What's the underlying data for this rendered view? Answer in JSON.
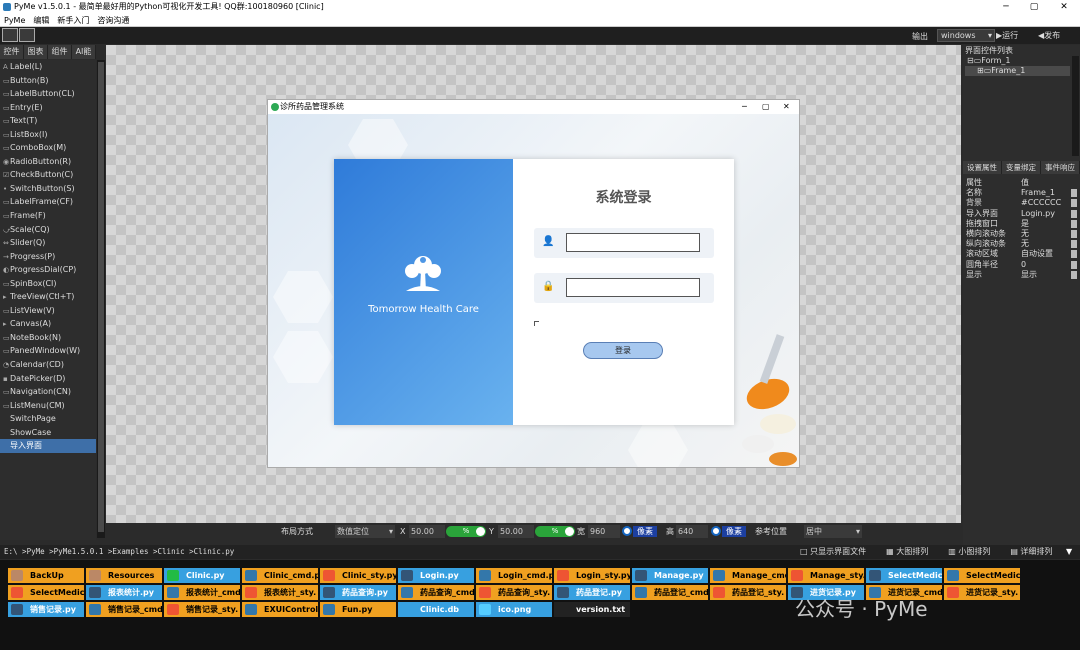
{
  "app": {
    "title": "PyMe v1.5.0.1 - 最简单最好用的Python可视化开发工具! QQ群:100180960    [Clinic]"
  },
  "menu": [
    "PyMe",
    "编辑",
    "新手入门",
    "咨询沟通"
  ],
  "toolbar": {
    "output_label": "输出",
    "platform": "windows",
    "run": "▶运行",
    "publish": "◀发布"
  },
  "left_tabs": [
    "控件",
    "图表",
    "组件",
    "AI能力"
  ],
  "controls": [
    {
      "icon": "A",
      "label": "Label(L)"
    },
    {
      "icon": "▭",
      "label": "Button(B)"
    },
    {
      "icon": "▭",
      "label": "LabelButton(CL)"
    },
    {
      "icon": "▭",
      "label": "Entry(E)"
    },
    {
      "icon": "▭",
      "label": "Text(T)"
    },
    {
      "icon": "▭",
      "label": "ListBox(I)"
    },
    {
      "icon": "▭",
      "label": "ComboBox(M)"
    },
    {
      "icon": "◉",
      "label": "RadioButton(R)"
    },
    {
      "icon": "☑",
      "label": "CheckButton(C)"
    },
    {
      "icon": "•",
      "label": "SwitchButton(S)"
    },
    {
      "icon": "▭",
      "label": "LabelFrame(CF)"
    },
    {
      "icon": "▭",
      "label": "Frame(F)"
    },
    {
      "icon": "⤻",
      "label": "Scale(CQ)"
    },
    {
      "icon": "⇔",
      "label": "Slider(Q)"
    },
    {
      "icon": "→",
      "label": "Progress(P)"
    },
    {
      "icon": "◐",
      "label": "ProgressDial(CP)"
    },
    {
      "icon": "▭",
      "label": "SpinBox(CI)"
    },
    {
      "icon": "▸",
      "label": "TreeView(Ctl+T)"
    },
    {
      "icon": "▭",
      "label": "ListView(V)"
    },
    {
      "icon": "▸",
      "label": "Canvas(A)"
    },
    {
      "icon": "▭",
      "label": "NoteBook(N)"
    },
    {
      "icon": "▭",
      "label": "PanedWindow(W)"
    },
    {
      "icon": "◔",
      "label": "Calendar(CD)"
    },
    {
      "icon": "▪",
      "label": "DatePicker(D)"
    },
    {
      "icon": "▭",
      "label": "Navigation(CN)"
    },
    {
      "icon": "▭",
      "label": "ListMenu(CM)"
    },
    {
      "icon": "",
      "label": "SwitchPage"
    },
    {
      "icon": "",
      "label": "ShowCase"
    },
    {
      "icon": "",
      "label": "导入界面"
    }
  ],
  "form": {
    "title": "诊所药品管理系统",
    "brand": "Tomorrow Health Care",
    "login_title": "系统登录",
    "login_button": "登录"
  },
  "right": {
    "title": "界面控件列表",
    "tree": [
      "⊟▭Form_1",
      "⊞▭Frame_1"
    ],
    "tabs": [
      "设置属性",
      "变量绑定",
      "事件响应"
    ],
    "props_header": {
      "k": "属性",
      "v": "值"
    },
    "props": [
      {
        "k": "名称",
        "v": "Frame_1"
      },
      {
        "k": "背景",
        "v": "#CCCCCC"
      },
      {
        "k": "导入界面",
        "v": "Login.py"
      },
      {
        "k": "拖拽窗口",
        "v": "是"
      },
      {
        "k": "横向滚动条",
        "v": "无"
      },
      {
        "k": "纵向滚动条",
        "v": "无"
      },
      {
        "k": "滚动区域",
        "v": "自动设置"
      },
      {
        "k": "圆角半径",
        "v": "0"
      },
      {
        "k": "显示",
        "v": "显示"
      }
    ]
  },
  "status": {
    "layout": "布局方式",
    "layout_value": "数值定位",
    "x_label": "X",
    "x_val": "50.00",
    "pct": "%",
    "y_label": "Y",
    "y_val": "50.00",
    "w_label": "宽",
    "w_val": "960",
    "unit": "像素",
    "h_label": "高",
    "h_val": "640",
    "anchor_label": "参考位置",
    "anchor_val": "居中"
  },
  "path": "E:\\ >PyMe >PyMe1.5.0.1 >Examples >Clinic >Clinic.py",
  "view_options": [
    "□ 只显示界面文件",
    "▦ 大图排列",
    "▥ 小图排列",
    "▤ 详细排列"
  ],
  "files": [
    {
      "name": "BackUp",
      "bg": "#f0a020",
      "fg": "#000",
      "ic": "#b86"
    },
    {
      "name": "Resources",
      "bg": "#f0a020",
      "fg": "#000",
      "ic": "#b86"
    },
    {
      "name": "Clinic.py",
      "bg": "#37a0e0",
      "fg": "#fff",
      "ic": "#2b4"
    },
    {
      "name": "Clinic_cmd.py",
      "bg": "#f0a020",
      "fg": "#000",
      "ic": "#37a"
    },
    {
      "name": "Clinic_sty.py",
      "bg": "#f0a020",
      "fg": "#000",
      "ic": "#e53"
    },
    {
      "name": "Login.py",
      "bg": "#37a0e0",
      "fg": "#fff",
      "ic": "#357"
    },
    {
      "name": "Login_cmd.py",
      "bg": "#f0a020",
      "fg": "#000",
      "ic": "#37a"
    },
    {
      "name": "Login_sty.py",
      "bg": "#f0a020",
      "fg": "#000",
      "ic": "#e53"
    },
    {
      "name": "Manage.py",
      "bg": "#37a0e0",
      "fg": "#fff",
      "ic": "#357"
    },
    {
      "name": "Manage_cmd.py",
      "bg": "#f0a020",
      "fg": "#000",
      "ic": "#37a"
    },
    {
      "name": "Manage_sty.py",
      "bg": "#f0a020",
      "fg": "#000",
      "ic": "#e53"
    },
    {
      "name": "SelectMedicD",
      "bg": "#37a0e0",
      "fg": "#fff",
      "ic": "#357"
    },
    {
      "name": "SelectMedicD",
      "bg": "#f0a020",
      "fg": "#000",
      "ic": "#37a"
    },
    {
      "name": "SelectMedicD",
      "bg": "#f0a020",
      "fg": "#000",
      "ic": "#e53"
    },
    {
      "name": "报表统计.py",
      "bg": "#37a0e0",
      "fg": "#fff",
      "ic": "#357"
    },
    {
      "name": "报表统计_cmd",
      "bg": "#f0a020",
      "fg": "#000",
      "ic": "#37a"
    },
    {
      "name": "报表统计_sty.",
      "bg": "#f0a020",
      "fg": "#000",
      "ic": "#e53"
    },
    {
      "name": "药品查询.py",
      "bg": "#37a0e0",
      "fg": "#fff",
      "ic": "#357"
    },
    {
      "name": "药品查询_cmd",
      "bg": "#f0a020",
      "fg": "#000",
      "ic": "#37a"
    },
    {
      "name": "药品查询_sty.",
      "bg": "#f0a020",
      "fg": "#000",
      "ic": "#e53"
    },
    {
      "name": "药品登记.py",
      "bg": "#37a0e0",
      "fg": "#fff",
      "ic": "#357"
    },
    {
      "name": "药品登记_cmd",
      "bg": "#f0a020",
      "fg": "#000",
      "ic": "#37a"
    },
    {
      "name": "药品登记_sty.",
      "bg": "#f0a020",
      "fg": "#000",
      "ic": "#e53"
    },
    {
      "name": "进货记录.py",
      "bg": "#37a0e0",
      "fg": "#fff",
      "ic": "#357"
    },
    {
      "name": "进货记录_cmd",
      "bg": "#f0a020",
      "fg": "#000",
      "ic": "#37a"
    },
    {
      "name": "进货记录_sty.",
      "bg": "#f0a020",
      "fg": "#000",
      "ic": "#e53"
    },
    {
      "name": "销售记录.py",
      "bg": "#37a0e0",
      "fg": "#fff",
      "ic": "#357"
    },
    {
      "name": "销售记录_cmd",
      "bg": "#f0a020",
      "fg": "#000",
      "ic": "#37a"
    },
    {
      "name": "销售记录_sty.",
      "bg": "#f0a020",
      "fg": "#000",
      "ic": "#e53"
    },
    {
      "name": "EXUIControl.p",
      "bg": "#f0a020",
      "fg": "#000",
      "ic": "#37a"
    },
    {
      "name": "Fun.py",
      "bg": "#f0a020",
      "fg": "#000",
      "ic": "#37a"
    },
    {
      "name": "Clinic.db",
      "bg": "#37a0e0",
      "fg": "#fff",
      "ic": "#37a0e0"
    },
    {
      "name": "ico.png",
      "bg": "#37a0e0",
      "fg": "#fff",
      "ic": "#5cf"
    },
    {
      "name": "version.txt",
      "bg": "#222",
      "fg": "#fff",
      "ic": "#222"
    }
  ],
  "watermark": "公众号 · PyMe"
}
